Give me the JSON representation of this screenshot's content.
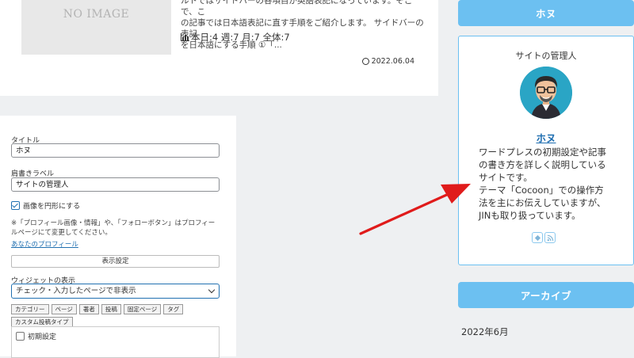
{
  "post": {
    "thumb_text": "NO IMAGE",
    "excerpt_line1": "ルトではサイドバーの各項目が英語表記になっています。そこで、こ",
    "excerpt_line2": "の記事では日本語表記に直す手順をご紹介します。 サイドバーの表記",
    "excerpt_line3": "を日本語にする手順 ①「...",
    "pv_text": "本日:4 週:7 月:7 全体:7",
    "date": "2022.06.04"
  },
  "widget_form": {
    "title_label": "タイトル",
    "title_value": "ホヌ",
    "caption_label": "肩書きラベル",
    "caption_value": "サイトの管理人",
    "circle_checkbox_label": "画像を円形にする",
    "note_line1": "※「プロフィール画像・情報」や、「フォローボタン」はプロフィー",
    "note_line2": "ルページにて変更してください。",
    "profile_link": "あなたのプロフィール",
    "display_settings_button": "表示設定",
    "widget_display_label": "ウィジェットの表示",
    "widget_display_value": "チェック・入力したページで非表示",
    "tabs": [
      "カテゴリー",
      "ページ",
      "著者",
      "投稿",
      "固定ページ",
      "タグ",
      "カスタム投稿タイプ"
    ],
    "tab_item": "初期設定"
  },
  "sidebar": {
    "top_header": "ホヌ",
    "profile_title": "サイトの管理人",
    "profile_name": "ホヌ",
    "profile_desc_1": "ワードプレスの初期設定や記事",
    "profile_desc_2": "の書き方を詳しく説明している",
    "profile_desc_3": "サイトです。",
    "profile_desc_4": "テーマ「Cocoon」での操作方",
    "profile_desc_5": "法を主にお伝えしていますが、",
    "profile_desc_6": "JINも取り扱っています。",
    "social_icons": [
      "feedly-icon",
      "rss-icon"
    ],
    "archive_header": "アーカイブ",
    "archive_item": "2022年6月"
  },
  "colors": {
    "sidebar_header_bg": "#6cc0f1",
    "arrow": "#e01b1b",
    "link": "#1d6db0"
  }
}
